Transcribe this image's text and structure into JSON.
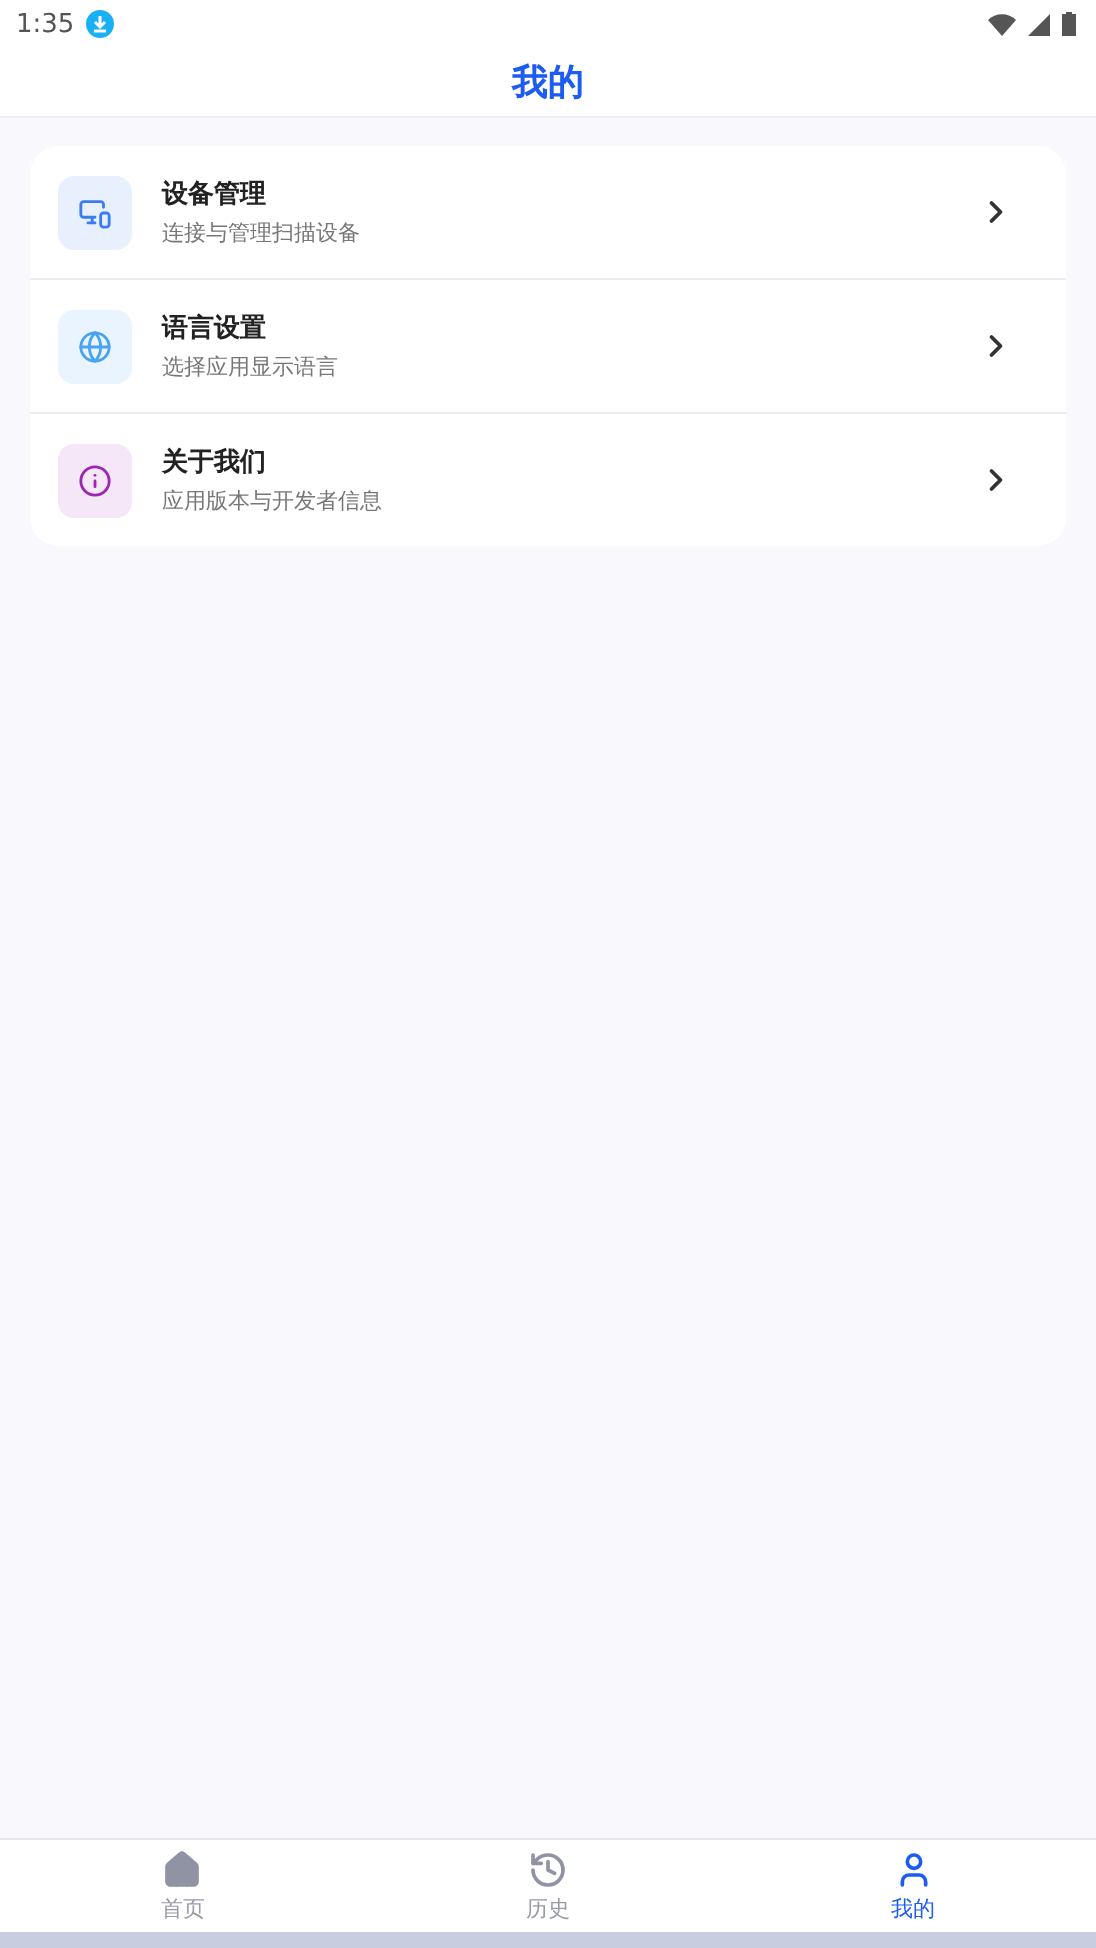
{
  "status_bar": {
    "time": "1:35"
  },
  "header": {
    "title": "我的"
  },
  "menu": [
    {
      "kind": "device",
      "title": "设备管理",
      "subtitle": "连接与管理扫描设备"
    },
    {
      "kind": "language",
      "title": "语言设置",
      "subtitle": "选择应用显示语言"
    },
    {
      "kind": "about",
      "title": "关于我们",
      "subtitle": "应用版本与开发者信息"
    }
  ],
  "tabs": [
    {
      "kind": "home",
      "label": "首页",
      "selected": false
    },
    {
      "kind": "history",
      "label": "历史",
      "selected": false
    },
    {
      "kind": "profile",
      "label": "我的",
      "selected": true
    }
  ]
}
